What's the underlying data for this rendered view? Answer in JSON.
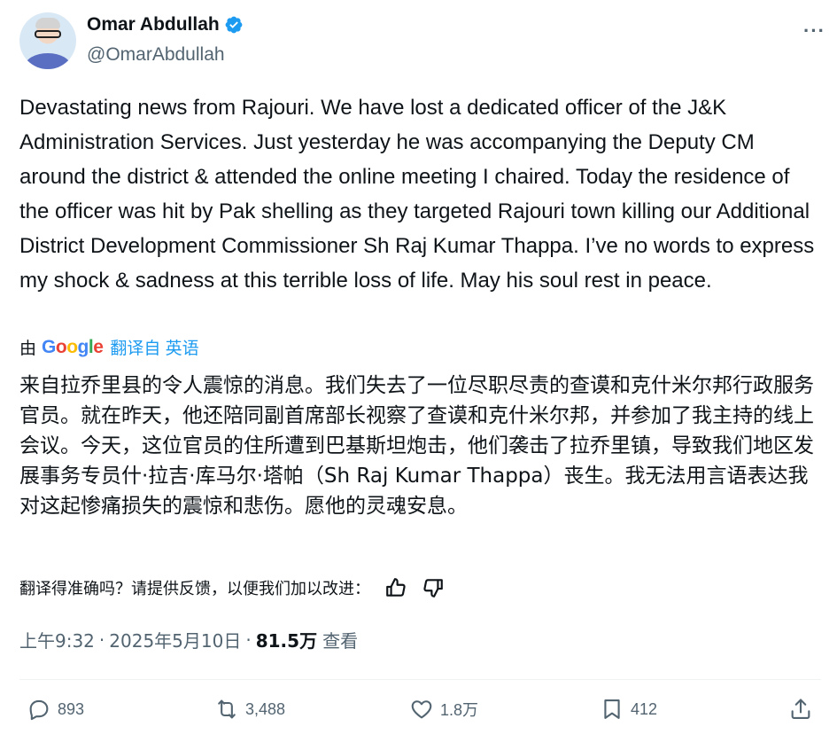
{
  "author": {
    "display_name": "Omar Abdullah",
    "handle": "@OmarAbdullah",
    "verified": true
  },
  "menu": {
    "icon": "more-horizontal-icon",
    "label": "···"
  },
  "tweet": {
    "text": "Devastating news from Rajouri. We have lost a dedicated officer of the J&K Administration Services. Just yesterday he was accompanying the Deputy CM around the district & attended the online meeting I chaired. Today the residence of the officer was hit by Pak shelling as they targeted Rajouri town killing our Additional District Development Commissioner Sh Raj Kumar Thappa. I’ve no words to express my shock & sadness at this terrible loss of life. May his soul rest in peace."
  },
  "translation": {
    "by_label": "由",
    "provider": "Google",
    "translated_from": "翻译自 英语",
    "text": "来自拉乔里县的令人震惊的消息。我们失去了一位尽职尽责的查谟和克什米尔邦行政服务官员。就在昨天，他还陪同副首席部长视察了查谟和克什米尔邦，并参加了我主持的线上会议。今天，这位官员的住所遭到巴基斯坦炮击，他们袭击了拉乔里镇，导致我们地区发展事务专员什·拉吉·库马尔·塔帕（Sh Raj Kumar Thappa）丧生。我无法用言语表达我对这起惨痛损失的震惊和悲伤。愿他的灵魂安息。",
    "feedback_prompt": "翻译得准确吗？请提供反馈，以便我们加以改进："
  },
  "meta": {
    "time": "上午9:32",
    "date": "2025年5月10日",
    "views": "81.5万",
    "views_label": "查看",
    "separator": "·"
  },
  "actions": {
    "replies": "893",
    "retweets": "3,488",
    "likes": "1.8万",
    "bookmarks": "412"
  },
  "colors": {
    "text": "#0f1419",
    "secondary": "#536471",
    "accent": "#1d9bf0",
    "divider": "#eff3f4"
  }
}
